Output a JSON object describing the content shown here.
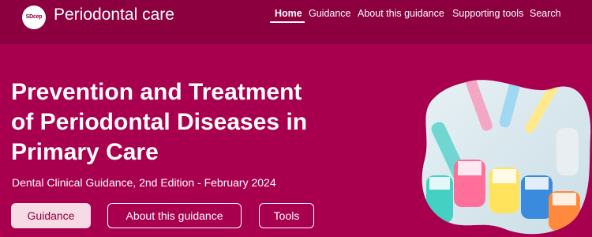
{
  "header": {
    "logo_text": "SDcep",
    "site_title": "Periodontal care",
    "nav": [
      {
        "label": "Home",
        "active": true
      },
      {
        "label": "Guidance"
      },
      {
        "label": "About this guidance"
      },
      {
        "label": "Supporting tools"
      },
      {
        "label": "Search"
      }
    ]
  },
  "hero": {
    "title_lines": [
      "Prevention and Treatment",
      "of Periodontal Diseases in",
      "Primary Care"
    ],
    "subtitle": "Dental Clinical Guidance, 2nd Edition - February 2024",
    "buttons": {
      "guidance": "Guidance",
      "about": "About this guidance",
      "tools": "Tools"
    },
    "image_icon": "toothbrushes-image"
  },
  "colors": {
    "header_bg": "#8c003f",
    "hero_bg": "#a8004f",
    "primary_button_bg": "#f6dbe4"
  }
}
